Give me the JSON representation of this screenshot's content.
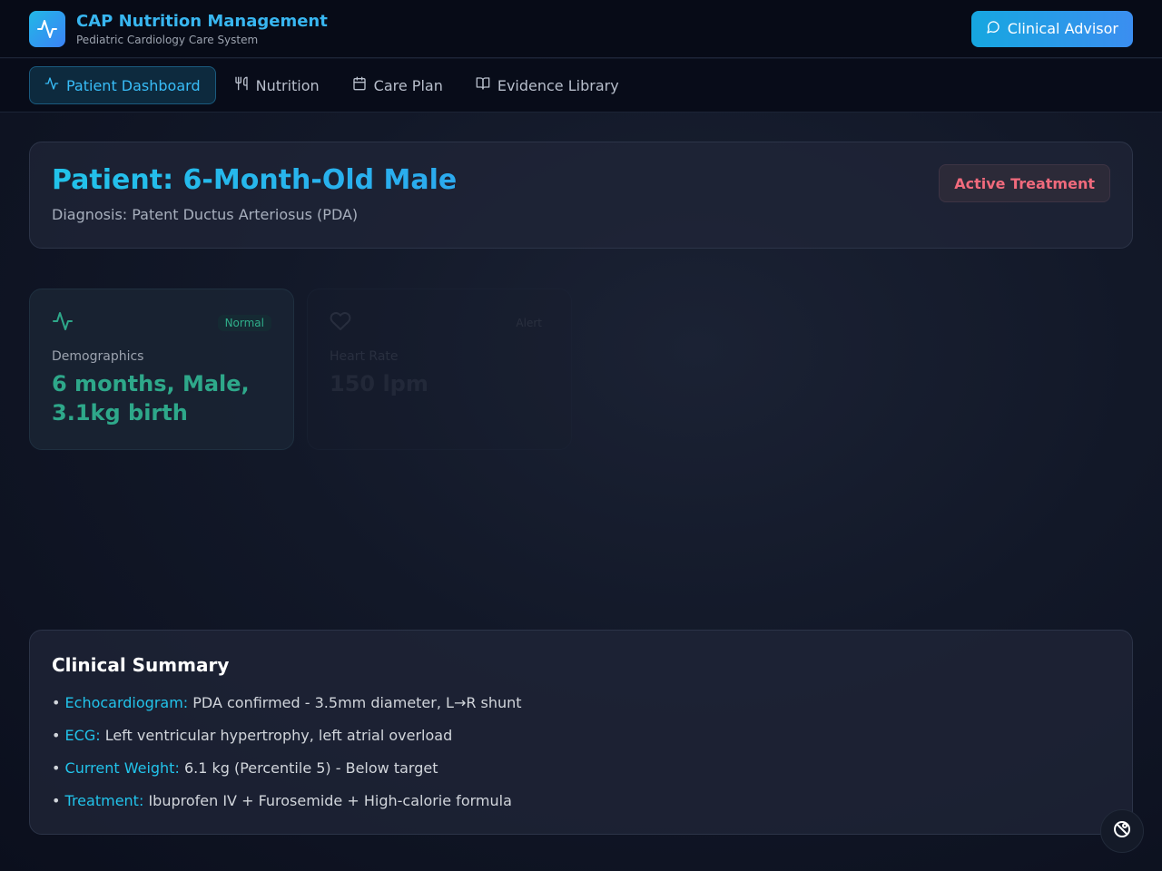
{
  "header": {
    "title": "CAP Nutrition Management",
    "subtitle": "Pediatric Cardiology Care System",
    "advisor_label": "Clinical Advisor"
  },
  "nav": {
    "tabs": [
      {
        "label": "Patient Dashboard",
        "icon": "activity-icon",
        "active": true
      },
      {
        "label": "Nutrition",
        "icon": "utensils-icon",
        "active": false
      },
      {
        "label": "Care Plan",
        "icon": "calendar-icon",
        "active": false
      },
      {
        "label": "Evidence Library",
        "icon": "book-open-icon",
        "active": false
      }
    ]
  },
  "patient": {
    "title": "Patient: 6-Month-Old Male",
    "diagnosis": "Diagnosis: Patent Ductus Arteriosus (PDA)",
    "status": "Active Treatment"
  },
  "metrics": [
    {
      "label": "Demographics",
      "value": "6 months, Male, 3.1kg birth",
      "tag": "Normal",
      "icon": "activity-icon"
    },
    {
      "label": "Heart Rate",
      "value": "150 lpm",
      "tag": "Alert",
      "icon": "heart-icon"
    }
  ],
  "summary": {
    "title": "Clinical Summary",
    "items": [
      {
        "key": "Echocardiogram:",
        "text": "PDA confirmed - 3.5mm diameter, L→R shunt"
      },
      {
        "key": "ECG:",
        "text": "Left ventricular hypertrophy, left atrial overload"
      },
      {
        "key": "Current Weight:",
        "text": "6.1 kg (Percentile 5) - Below target"
      },
      {
        "key": "Treatment:",
        "text": "Ibuprofen IV + Furosemide + High-calorie formula"
      }
    ]
  },
  "colors": {
    "accent": "#22c3ea",
    "normal": "#2ea88a",
    "alert": "#f06a7c",
    "background": "#0b0f1d"
  }
}
